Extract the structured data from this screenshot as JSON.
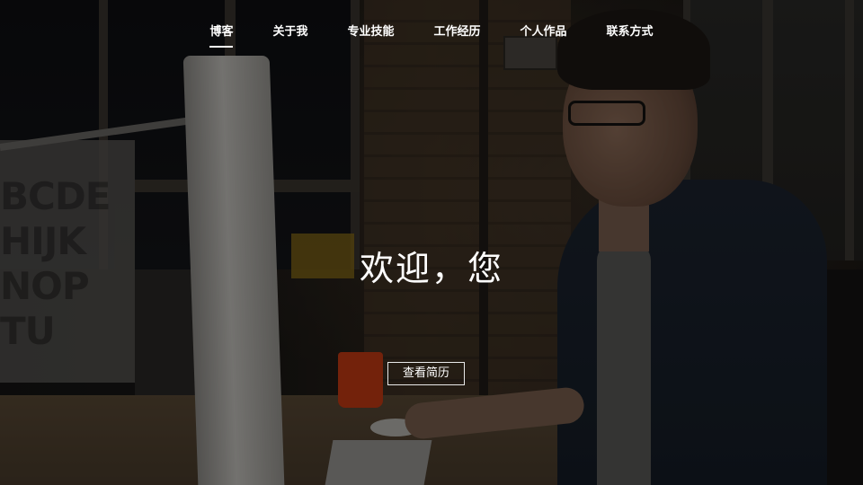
{
  "nav": {
    "items": [
      {
        "label": "博客",
        "active": true
      },
      {
        "label": "关于我",
        "active": false
      },
      {
        "label": "专业技能",
        "active": false
      },
      {
        "label": "工作经历",
        "active": false
      },
      {
        "label": "个人作品",
        "active": false
      },
      {
        "label": "联系方式",
        "active": false
      }
    ]
  },
  "hero": {
    "heading": "欢迎，您",
    "cta_label": "查看简历",
    "poster_letters": "BCDE\nHIJK\nNOP\nTU"
  },
  "colors": {
    "text": "#ffffff",
    "overlay": "rgba(0,0,0,0.42)",
    "mug": "#c63b14"
  }
}
